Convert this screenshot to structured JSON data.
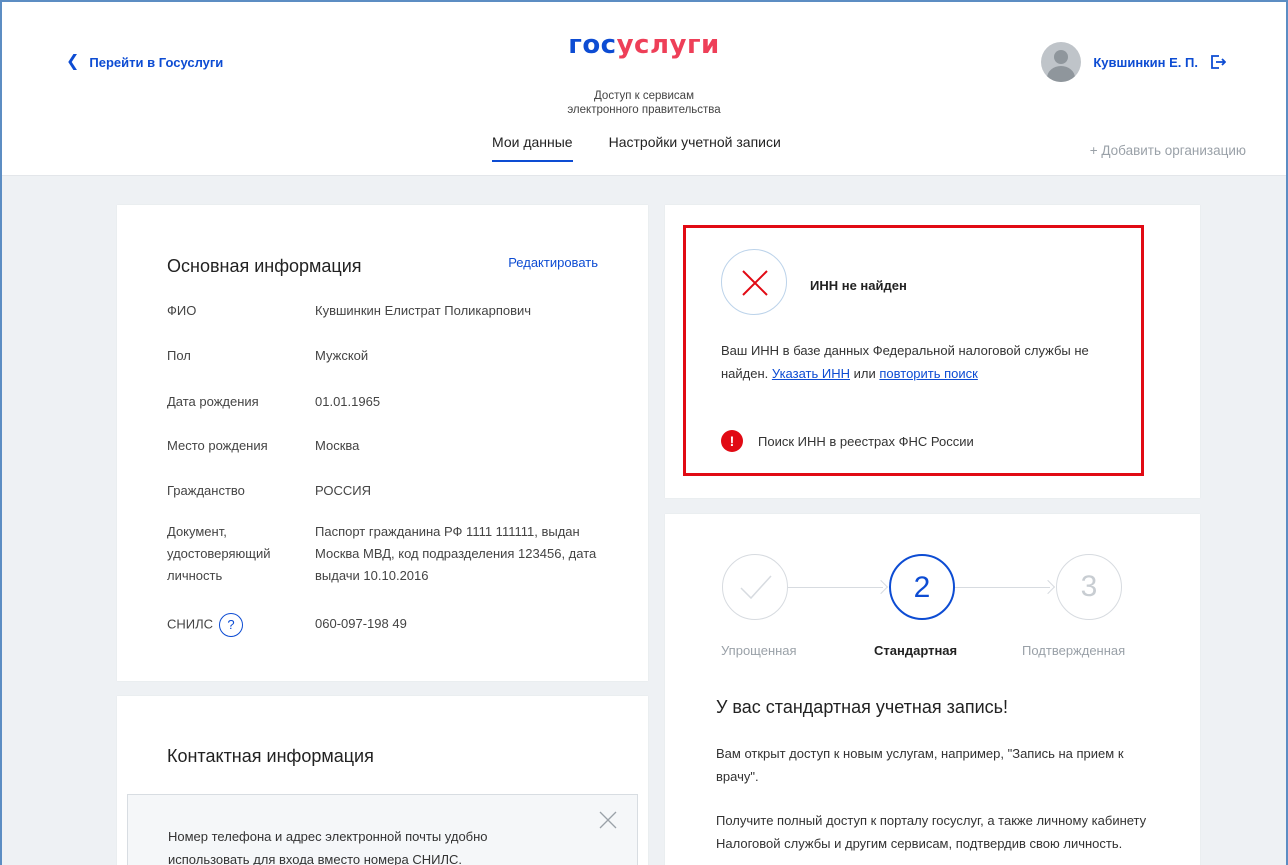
{
  "header": {
    "back_label": "Перейти в Госуслуги",
    "logo_part1": "гос",
    "logo_part2": "услуги",
    "subtitle_line1": "Доступ к сервисам",
    "subtitle_line2": "электронного правительства",
    "user_name": "Кувшинкин Е. П.",
    "tabs": [
      {
        "label": "Мои данные",
        "active": true
      },
      {
        "label": "Настройки учетной записи",
        "active": false
      }
    ],
    "add_org": "+ Добавить организацию"
  },
  "main_info": {
    "title": "Основная информация",
    "edit_label": "Редактировать",
    "rows": [
      {
        "label": "ФИО",
        "value": "Кувшинкин Елистрат Поликарпович"
      },
      {
        "label": "Пол",
        "value": "Мужской"
      },
      {
        "label": "Дата рождения",
        "value": "01.01.1965"
      },
      {
        "label": "Место рождения",
        "value": "Москва"
      },
      {
        "label": "Гражданство",
        "value": "РОССИЯ"
      },
      {
        "label": "Документ, удостоверяющий личность",
        "value": "Паспорт гражданина РФ 1111 111111, выдан Москва МВД, код подразделения 123456, дата выдачи 10.10.2016"
      },
      {
        "label": "СНИЛС",
        "value": "060-097-198 49"
      }
    ],
    "help_glyph": "?"
  },
  "contact_info": {
    "title": "Контактная информация",
    "notice_text": "Номер телефона и адрес электронной почты удобно использовать для входа вместо номера СНИЛС."
  },
  "inn": {
    "title": "ИНН не найден",
    "text_before": "Ваш ИНН в базе данных Федеральной налоговой службы не найден.",
    "link_specify": "Указать ИНН",
    "text_or": "или",
    "link_retry": "повторить поиск",
    "search_label": "Поиск ИНН в реестрах ФНС России",
    "warn_glyph": "!"
  },
  "account_status": {
    "steps": [
      {
        "label": "Упрощенная",
        "number": ""
      },
      {
        "label": "Стандартная",
        "number": "2"
      },
      {
        "label": "Подтвержденная",
        "number": "3"
      }
    ],
    "title": "У вас стандартная учетная запись!",
    "text1": "Вам открыт доступ к новым услугам, например, \"Запись на прием к врачу\".",
    "text2": "Получите полный доступ к порталу госуслуг, а также личному кабинету Налоговой службы и другим сервисам, подтвердив свою личность."
  },
  "colors": {
    "accent": "#0d4cd3",
    "brand_red": "#ee3f58",
    "error": "#e10a14",
    "muted": "#9aa1a8"
  },
  "icons": {
    "back": "chevron-left-icon",
    "logout": "logout-icon",
    "help": "question-circle-icon",
    "close": "close-icon",
    "error": "cross-icon",
    "warning": "exclamation-icon",
    "done": "check-icon"
  }
}
